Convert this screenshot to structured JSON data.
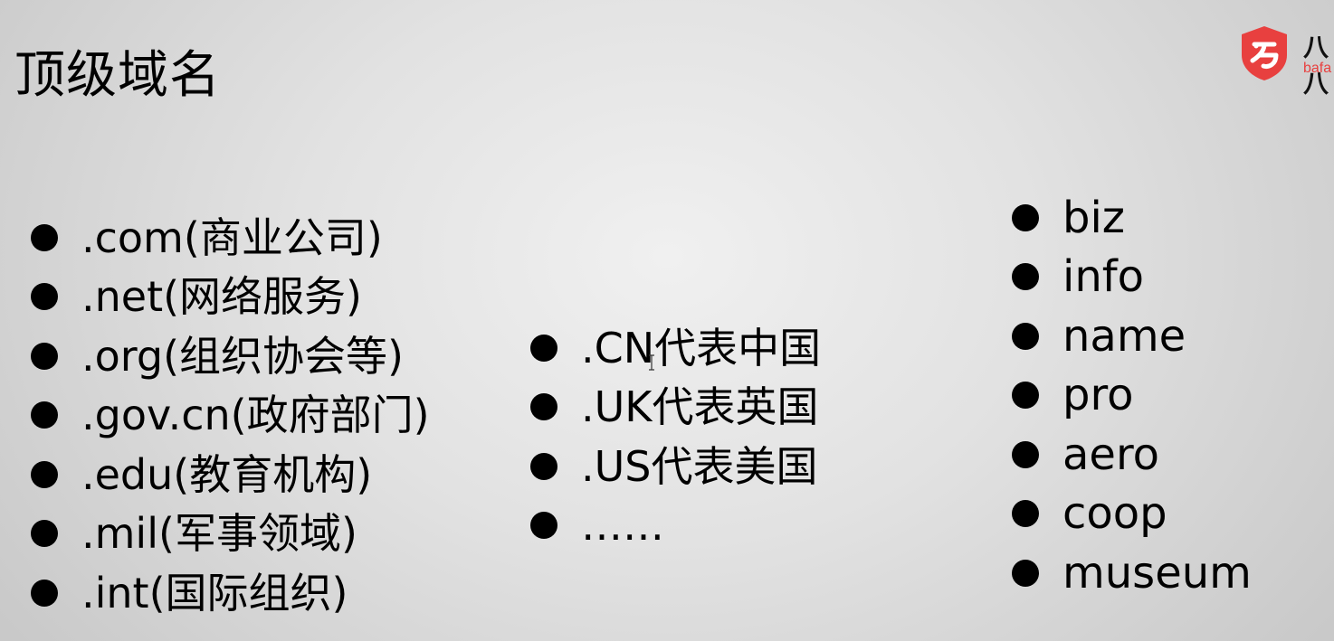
{
  "title": "顶级域名",
  "logo": {
    "text": "八八",
    "sub": "bafa",
    "badge_color": "#e8403f",
    "icon": "brand-shield-icon"
  },
  "column_general": [
    ".com(商业公司)",
    ".net(网络服务)",
    ".org(组织协会等)",
    ".gov.cn(政府部门)",
    ".edu(教育机构)",
    ".mil(军事领域)",
    ".int(国际组织)"
  ],
  "column_country": [
    ".CN代表中国",
    ".UK代表英国",
    ".US代表美国",
    "……"
  ],
  "column_new": [
    "biz",
    "info",
    "name",
    "pro",
    "aero",
    "coop",
    "museum"
  ]
}
